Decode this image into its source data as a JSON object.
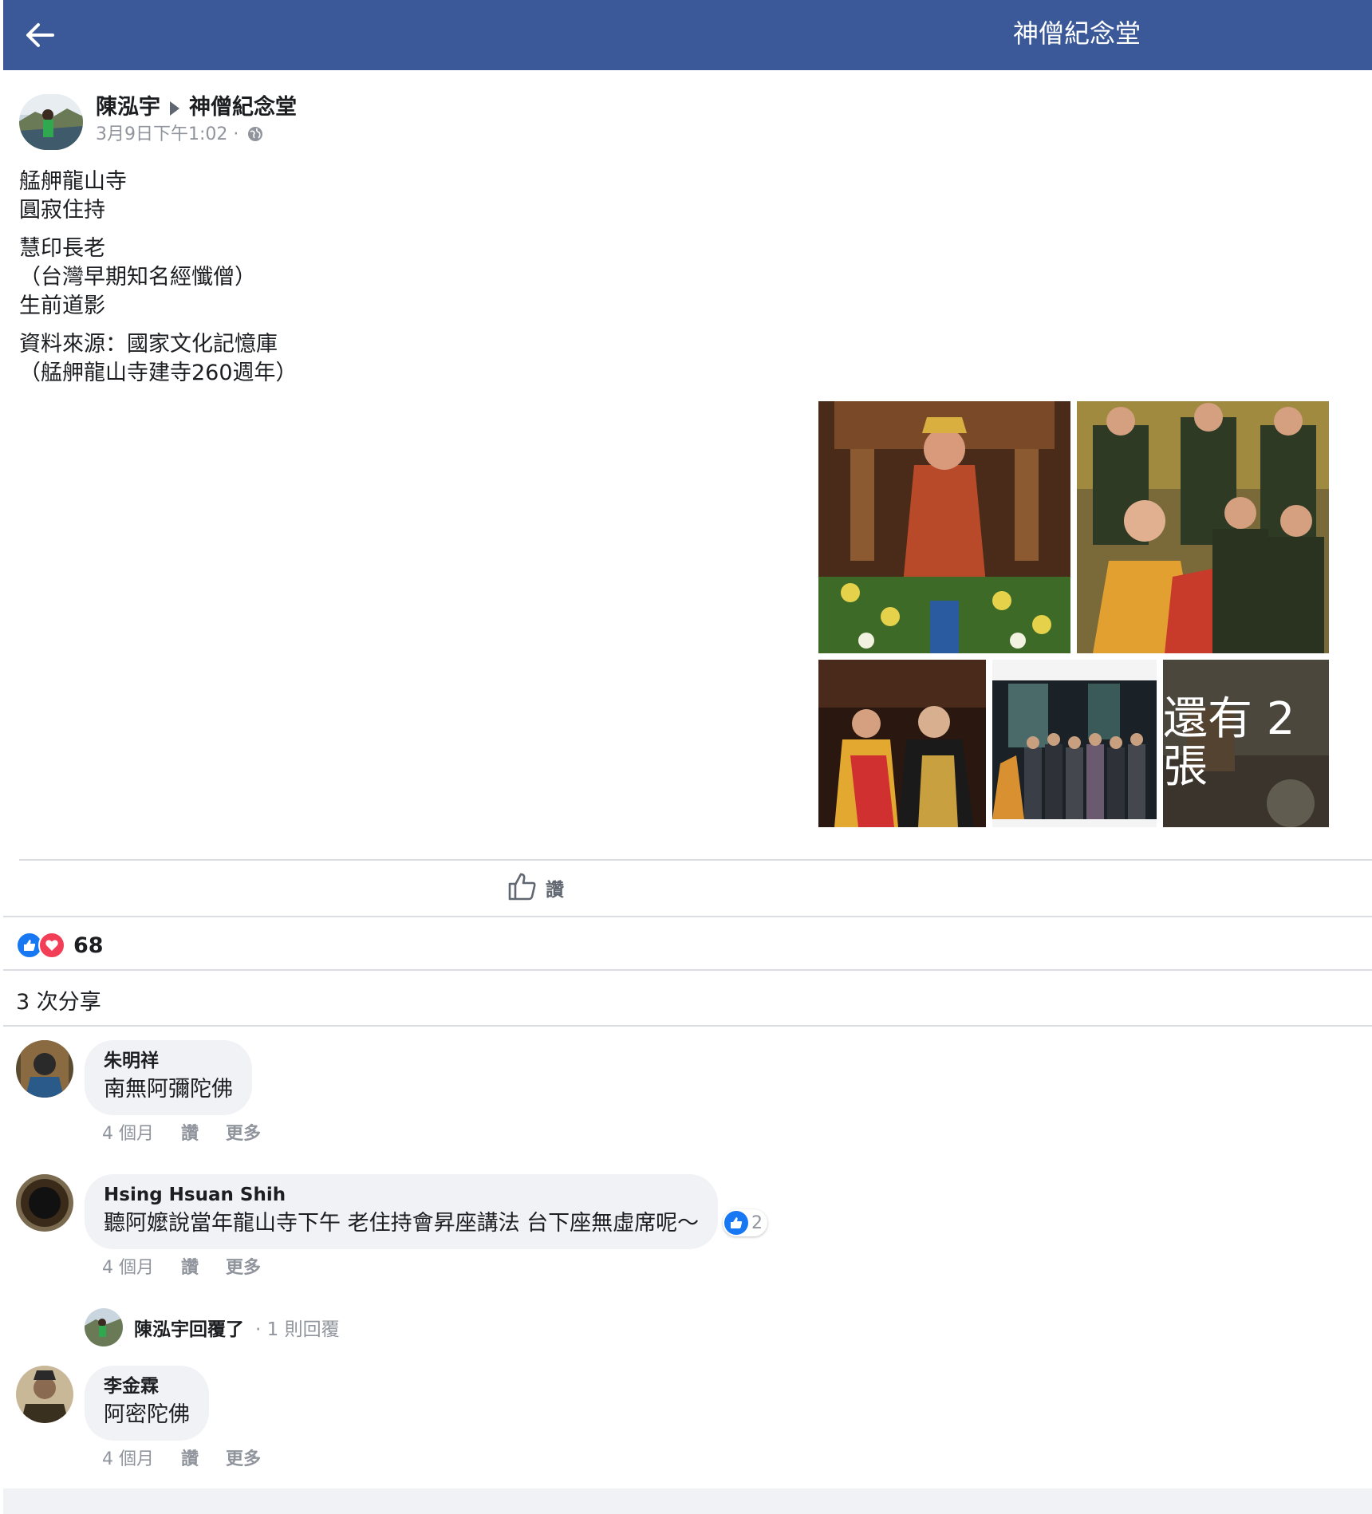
{
  "topbar": {
    "title": "神僧紀念堂",
    "back_icon": "arrow-left-icon"
  },
  "post": {
    "author": "陳泓宇",
    "target_page": "神僧紀念堂",
    "timestamp": "3月9日下午1:02 ·",
    "privacy_icon": "globe-icon",
    "text_paragraphs": [
      "艋舺龍山寺\n圓寂住持",
      "慧印長老\n（台灣早期知名經懺僧）\n生前道影",
      "資料來源：國家文化記憶庫\n（艋舺龍山寺建寺260週年）"
    ],
    "photos_more_label": "還有 2 張"
  },
  "actions": {
    "like_label": "讚",
    "like_icon": "thumbs-up-icon"
  },
  "stats": {
    "reaction_count": "68",
    "shares": "3 次分享",
    "reaction_icons": [
      "like-icon",
      "love-icon"
    ]
  },
  "comments": [
    {
      "name": "朱明祥",
      "text": "南無阿彌陀佛",
      "time": "4 個月",
      "like": "讚",
      "more": "更多"
    },
    {
      "name": "Hsing Hsuan Shih",
      "text": "聽阿嬤說當年龍山寺下午 老住持會昇座講法 台下座無虛席呢～",
      "time": "4 個月",
      "like": "讚",
      "more": "更多",
      "like_count": "2"
    },
    {
      "name": "李金霖",
      "text": "阿密陀佛",
      "time": "4 個月",
      "like": "讚",
      "more": "更多"
    }
  ],
  "reply_summary": {
    "name": "陳泓宇回覆了",
    "count": "· 1 則回覆"
  },
  "colors": {
    "brand": "#3b5998",
    "like_blue": "#1877f2",
    "love_red": "#f33e58"
  }
}
